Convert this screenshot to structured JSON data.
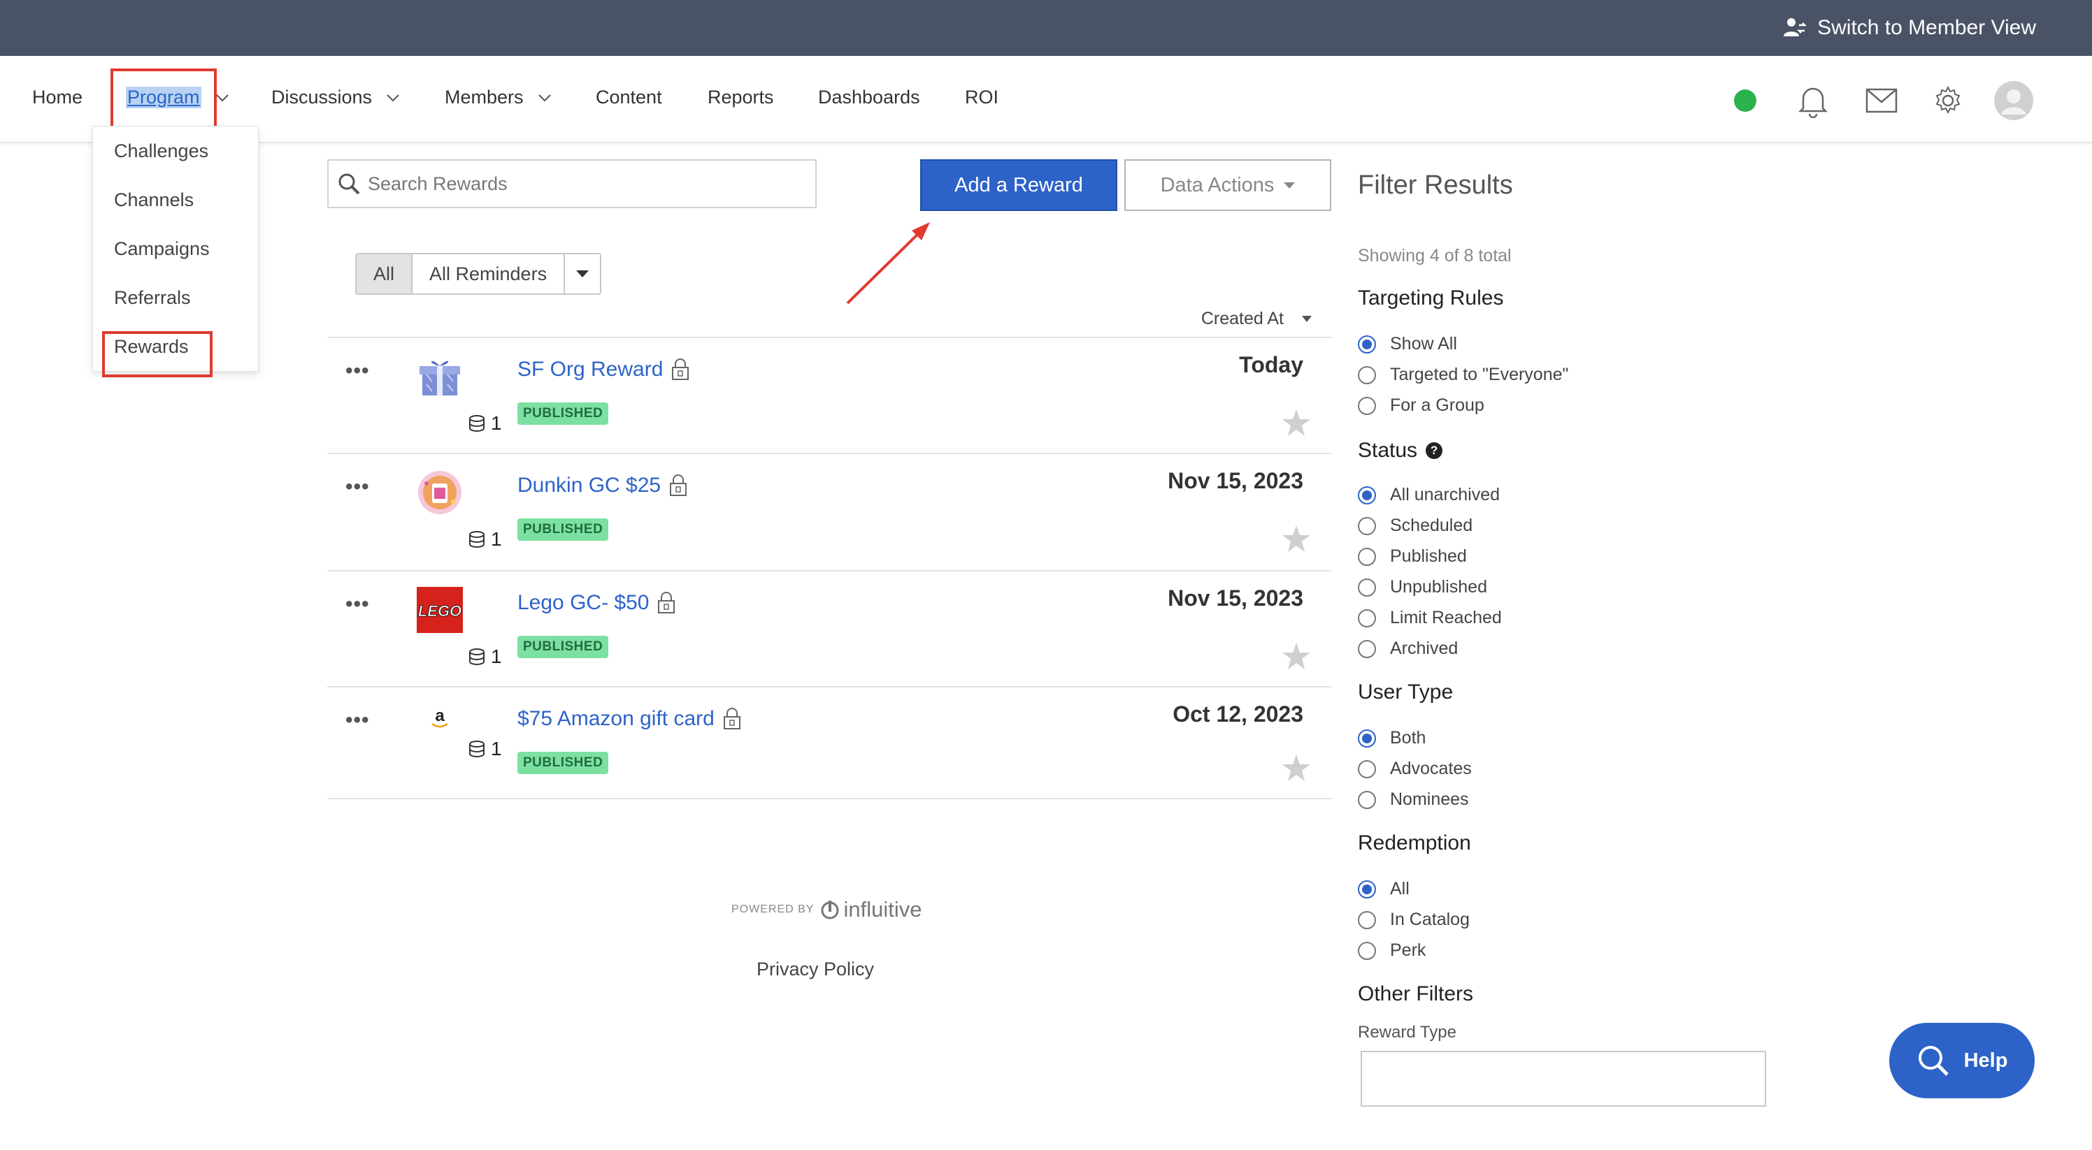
{
  "header": {
    "switch_view_label": "Switch to Member View"
  },
  "nav": {
    "items": [
      {
        "label": "Home"
      },
      {
        "label": "Program"
      },
      {
        "label": "Discussions"
      },
      {
        "label": "Members"
      },
      {
        "label": "Content"
      },
      {
        "label": "Reports"
      },
      {
        "label": "Dashboards"
      },
      {
        "label": "ROI"
      }
    ],
    "status_color": "#2bb24c"
  },
  "program_menu": {
    "items": [
      {
        "label": "Challenges"
      },
      {
        "label": "Channels"
      },
      {
        "label": "Campaigns"
      },
      {
        "label": "Referrals"
      },
      {
        "label": "Rewards"
      }
    ]
  },
  "toolbar": {
    "search_placeholder": "Search Rewards",
    "add_button": "Add a Reward",
    "data_actions": "Data Actions"
  },
  "segmented": {
    "all": "All",
    "reminders": "All Reminders"
  },
  "sort": {
    "label": "Created At"
  },
  "rewards": [
    {
      "title": "SF Org Reward",
      "status": "PUBLISHED",
      "coins": "1",
      "date": "Today",
      "icon": "gift-icon"
    },
    {
      "title": "Dunkin GC $25",
      "status": "PUBLISHED",
      "coins": "1",
      "date": "Nov 15, 2023",
      "icon": "dunkin-logo"
    },
    {
      "title": "Lego GC- $50",
      "status": "PUBLISHED",
      "coins": "1",
      "date": "Nov 15, 2023",
      "icon": "lego-logo"
    },
    {
      "title": "$75 Amazon gift card",
      "status": "PUBLISHED",
      "coins": "1",
      "date": "Oct 12, 2023",
      "icon": "amazon-logo"
    }
  ],
  "lego_logo_text": "LEGO",
  "amazon_logo_text": "a",
  "footer": {
    "powered_by": "POWERED BY",
    "brand": "influitive",
    "privacy": "Privacy Policy"
  },
  "filters": {
    "title": "Filter Results",
    "showing": "Showing 4 of 8 total",
    "targeting": {
      "heading": "Targeting Rules",
      "options": [
        "Show All",
        "Targeted to \"Everyone\"",
        "For a Group"
      ],
      "selected": 0
    },
    "status": {
      "heading": "Status",
      "help": "?",
      "options": [
        "All unarchived",
        "Scheduled",
        "Published",
        "Unpublished",
        "Limit Reached",
        "Archived"
      ],
      "selected": 0
    },
    "user_type": {
      "heading": "User Type",
      "options": [
        "Both",
        "Advocates",
        "Nominees"
      ],
      "selected": 0
    },
    "redemption": {
      "heading": "Redemption",
      "options": [
        "All",
        "In Catalog",
        "Perk"
      ],
      "selected": 0
    },
    "other": {
      "heading": "Other Filters",
      "reward_type_label": "Reward Type"
    }
  },
  "help_button": "Help",
  "colors": {
    "topbar": "#4a5366",
    "primary": "#2d63c8",
    "published_badge": "#7de0a3",
    "annotation_red": "#e03a2f"
  }
}
